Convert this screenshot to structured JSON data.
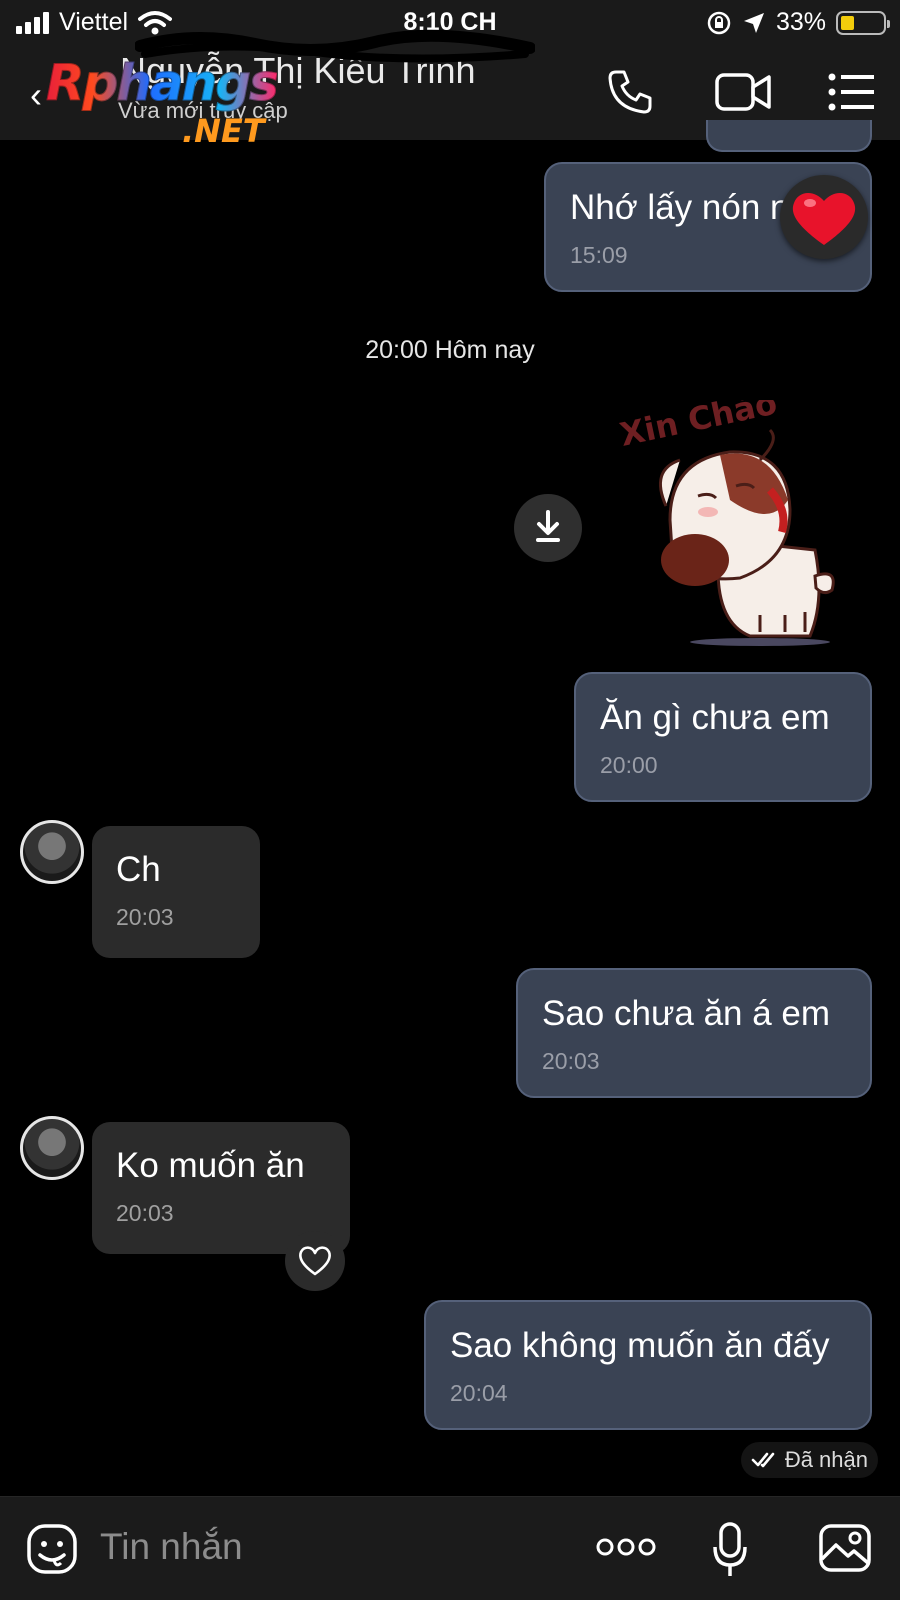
{
  "status_bar": {
    "carrier": "Viettel",
    "time": "8:10 CH",
    "battery_percent": "33%",
    "battery_level": 0.33
  },
  "header": {
    "contact_name": "Nguyễn Thị Kiều Trinh",
    "contact_status": "Vừa mới truy cập",
    "watermark_main": "Rphangs",
    "watermark_net": ".NET",
    "icons": [
      "back-icon",
      "phone-icon",
      "video-call-icon",
      "menu-list-icon"
    ]
  },
  "conversation": {
    "day_divider": "20:00 Hôm nay",
    "messages": [
      {
        "direction": "out",
        "text": "Nhớ lấy nón n",
        "time": "15:09",
        "reaction": "heart"
      },
      {
        "direction": "out",
        "type": "sticker",
        "sticker_text": "Xin Chào"
      },
      {
        "direction": "out",
        "text": "Ăn gì chưa em",
        "time": "20:00"
      },
      {
        "direction": "in",
        "text": "Ch",
        "time": "20:03"
      },
      {
        "direction": "out",
        "text": "Sao chưa ăn á em",
        "time": "20:03"
      },
      {
        "direction": "in",
        "text": "Ko muốn ăn",
        "time": "20:03"
      },
      {
        "direction": "out",
        "text": "Sao không muốn ăn đấy",
        "time": "20:04"
      }
    ],
    "receipt": "Đã nhận"
  },
  "input_bar": {
    "placeholder": "Tin nhắn",
    "icons": [
      "emoji-icon",
      "more-icon",
      "microphone-icon",
      "image-icon"
    ]
  },
  "colors": {
    "background": "#000000",
    "bar": "#1a1a1a",
    "outgoing_bubble": "#3a4354",
    "incoming_bubble": "#2b2b2b",
    "heart": "#e8132b",
    "battery": "#f2cc0c"
  }
}
